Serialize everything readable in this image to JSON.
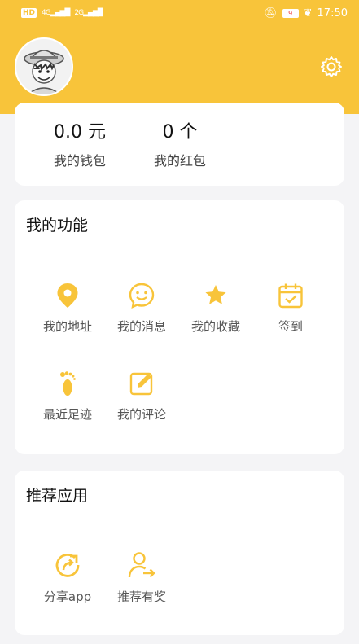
{
  "status_bar": {
    "left_chip": "HD",
    "signal_1": "4G",
    "signal_2": "2G",
    "battery": "9",
    "time": "17:50"
  },
  "header": {
    "avatar_icon": "cartoon-avatar-icon",
    "settings_icon": "gear-icon",
    "accent_color": "#f8c43a"
  },
  "wallet": {
    "balance_value": "0.0 元",
    "balance_label": "我的钱包",
    "redpacket_value": "0 个",
    "redpacket_label": "我的红包"
  },
  "functions": {
    "title": "我的功能",
    "items": [
      {
        "label": "我的地址",
        "icon": "location-pin-icon"
      },
      {
        "label": "我的消息",
        "icon": "message-smile-icon"
      },
      {
        "label": "我的收藏",
        "icon": "star-icon"
      },
      {
        "label": "签到",
        "icon": "calendar-check-icon"
      },
      {
        "label": "最近足迹",
        "icon": "footprint-icon"
      },
      {
        "label": "我的评论",
        "icon": "edit-icon"
      }
    ]
  },
  "recommend": {
    "title": "推荐应用",
    "items": [
      {
        "label": "分享app",
        "icon": "share-refresh-icon"
      },
      {
        "label": "推荐有奖",
        "icon": "user-arrow-icon"
      }
    ]
  }
}
